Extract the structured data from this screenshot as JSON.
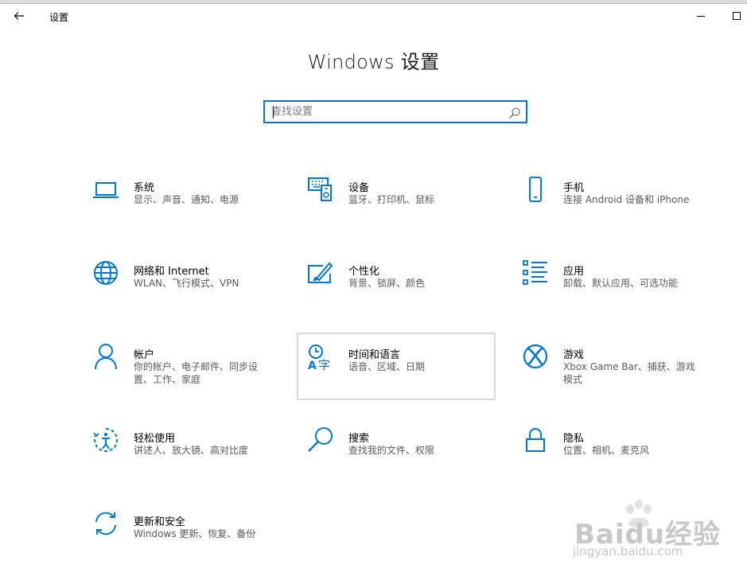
{
  "window": {
    "app_title": "设置",
    "back_icon": "arrow-left-icon",
    "minimize_icon": "minimize-icon",
    "maximize_icon": "maximize-icon"
  },
  "page": {
    "title": "Windows 设置"
  },
  "search": {
    "placeholder": "查找设置",
    "icon": "search-icon"
  },
  "accent_color": "#0078d7",
  "tiles": [
    {
      "title": "系统",
      "description": "显示、声音、通知、电源",
      "icon": "laptop-icon"
    },
    {
      "title": "设备",
      "description": "蓝牙、打印机、鼠标",
      "icon": "keyboard-devices-icon"
    },
    {
      "title": "手机",
      "description": "连接 Android 设备和 iPhone",
      "icon": "phone-icon"
    },
    {
      "title": "网络和 Internet",
      "description": "WLAN、飞行模式、VPN",
      "icon": "globe-icon"
    },
    {
      "title": "个性化",
      "description": "背景、锁屏、颜色",
      "icon": "paint-brush-icon"
    },
    {
      "title": "应用",
      "description": "卸载、默认应用、可选功能",
      "icon": "apps-list-icon"
    },
    {
      "title": "帐户",
      "description": "你的帐户、电子邮件、同步设置、工作、家庭",
      "icon": "person-icon"
    },
    {
      "title": "时间和语言",
      "description": "语音、区域、日期",
      "icon": "time-language-icon"
    },
    {
      "title": "游戏",
      "description": "Xbox Game Bar、捕获、游戏模式",
      "icon": "xbox-icon"
    },
    {
      "title": "轻松使用",
      "description": "讲述人、放大镜、高对比度",
      "icon": "ease-of-access-icon"
    },
    {
      "title": "搜索",
      "description": "查找我的文件、权限",
      "icon": "magnifier-icon"
    },
    {
      "title": "隐私",
      "description": "位置、相机、麦克风",
      "icon": "lock-icon"
    },
    {
      "title": "更新和安全",
      "description": "Windows 更新、恢复、备份",
      "icon": "sync-icon"
    }
  ],
  "watermark": {
    "main": "Baidu经验",
    "sub": "jingyan.baidu.com"
  }
}
